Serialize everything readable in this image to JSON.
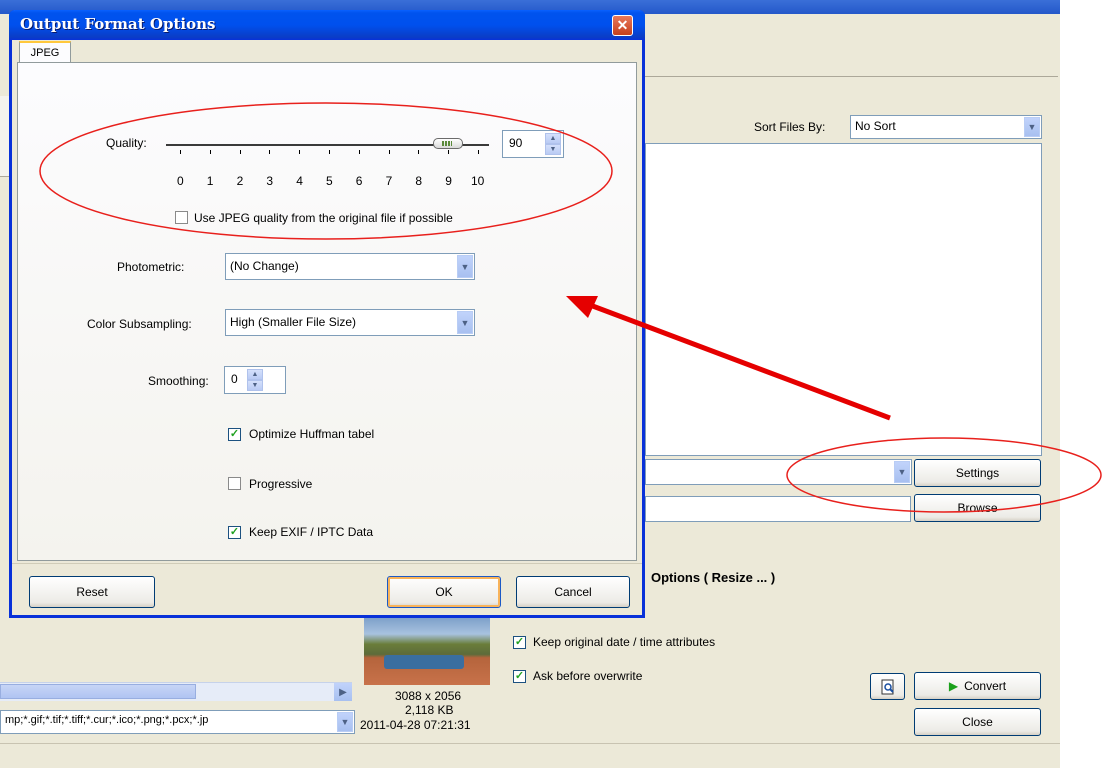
{
  "dialog": {
    "title": "Output Format Options",
    "tab": "JPEG",
    "quality": {
      "label": "Quality:",
      "value": "90",
      "ticks": [
        "0",
        "1",
        "2",
        "3",
        "4",
        "5",
        "6",
        "7",
        "8",
        "9",
        "10"
      ],
      "slider_fraction": 0.9
    },
    "use_original_quality": {
      "label": "Use JPEG quality from the original file if possible",
      "checked": false
    },
    "photometric": {
      "label": "Photometric:",
      "value": "(No Change)"
    },
    "color_subsampling": {
      "label": "Color Subsampling:",
      "value": "High (Smaller File Size)"
    },
    "smoothing": {
      "label": "Smoothing:",
      "value": "0"
    },
    "optimize_huffman": {
      "label": "Optimize Huffman tabel",
      "checked": true
    },
    "progressive": {
      "label": "Progressive",
      "checked": false
    },
    "keep_exif": {
      "label": "Keep EXIF / IPTC Data",
      "checked": true
    },
    "buttons": {
      "reset": "Reset",
      "ok": "OK",
      "cancel": "Cancel"
    }
  },
  "main": {
    "sort_label": "Sort Files By:",
    "sort_value": "No Sort",
    "settings_button": "Settings",
    "browse_button": "Browse",
    "options_heading": "Options ( Resize ... )",
    "keep_date_label": "Keep original date / time attributes",
    "ask_overwrite_label": "Ask before overwrite",
    "convert_button": "Convert",
    "close_button": "Close",
    "file_filter": "mp;*.gif;*.tif;*.tiff;*.cur;*.ico;*.png;*.pcx;*.jp",
    "image_info": {
      "dimensions": "3088 x 2056",
      "size": "2,118 KB",
      "date": "2011-04-28 07:21:31"
    }
  },
  "colors": {
    "annotation": "#e8201c",
    "arrow": "#e50000",
    "titlebar": "#0054e3",
    "check": "#21a121"
  },
  "icons": [
    "close-icon",
    "dropdown-arrow-icon",
    "spin-up-icon",
    "spin-down-icon",
    "checkmark-icon",
    "preview-icon",
    "play-icon",
    "scroll-right-icon"
  ]
}
